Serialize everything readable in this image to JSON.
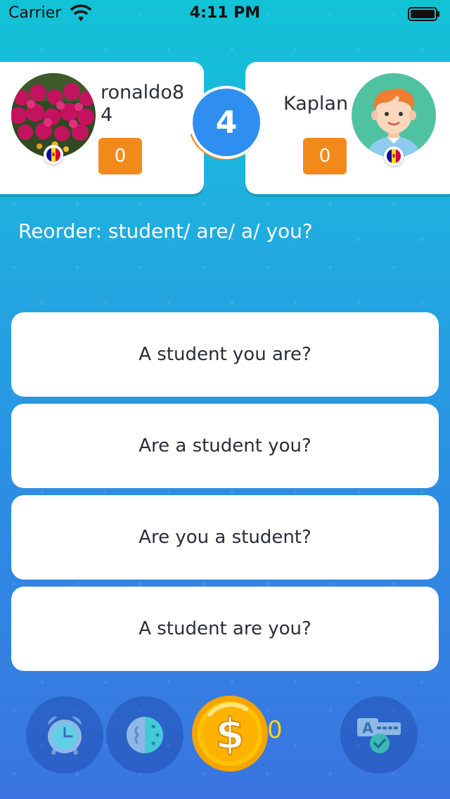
{
  "status_bar": {
    "carrier": "Carrier",
    "time": "4:11 PM"
  },
  "round": {
    "number": "4"
  },
  "players": {
    "left": {
      "name": "ronaldo84",
      "score": "0"
    },
    "right": {
      "name": "Kaplan",
      "score": "0"
    }
  },
  "question": {
    "text": "Reorder: student/ are/ a/ you?"
  },
  "answers": [
    {
      "label": "A student you are?"
    },
    {
      "label": "Are a student you?"
    },
    {
      "label": "Are you a student?"
    },
    {
      "label": "A student are you?"
    }
  ],
  "toolbar": {
    "coins": "0",
    "icons": [
      "alarm-clock-icon",
      "half-brain-icon",
      "dollar-coin-icon",
      "answer-check-icon"
    ]
  },
  "colors": {
    "score_badge": "#f28a1b",
    "round_circle": "#2e8ff0",
    "coin": "#ffc400"
  }
}
